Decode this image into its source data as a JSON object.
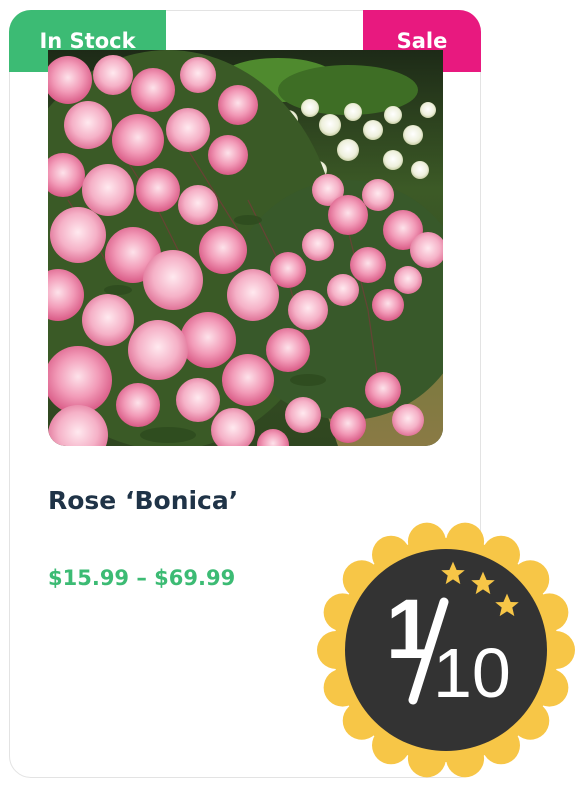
{
  "badges": {
    "in_stock": "In Stock",
    "sale": "Sale"
  },
  "product": {
    "name": "Rose ‘Bonica’",
    "price_range": "$15.99 – $69.99",
    "image_icon": "pink-rose-bush-photo"
  },
  "rating": {
    "numerator": "1",
    "denominator": "10",
    "stars": 3
  },
  "colors": {
    "in_stock": "#3cbb74",
    "sale": "#e8197f",
    "title": "#1f3347",
    "price": "#3cbb74",
    "seal_scallop": "#f7c647",
    "seal_disc": "#333333"
  }
}
